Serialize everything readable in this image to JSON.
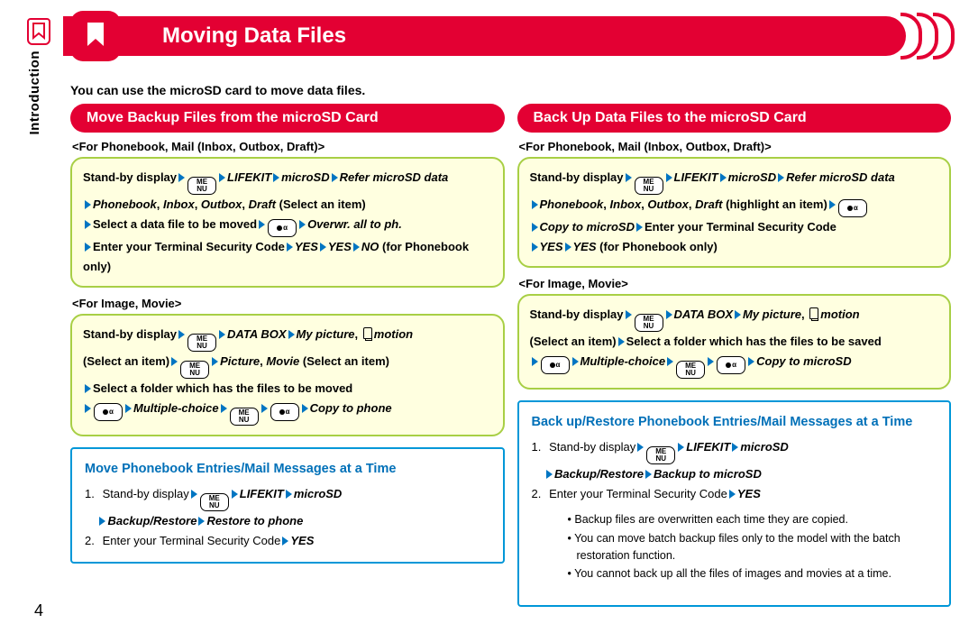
{
  "sidebar_label": "Introduction",
  "header_title": "Moving Data Files",
  "intro": "You can use the microSD card to move data files.",
  "page_number": "4",
  "keys": {
    "menu": "ME\nNU",
    "ir": "α"
  },
  "left": {
    "title": "Move Backup Files from the microSD Card",
    "sec1_heading": "<For Phonebook, Mail (Inbox, Outbox, Draft)>",
    "sec1": {
      "t1": "Stand-by display",
      "t2": "LIFEKIT",
      "t3": "microSD",
      "t4": "Refer microSD data",
      "t5": "Phonebook",
      "t6": "Inbox",
      "t7": "Outbox",
      "t8": "Draft",
      "t9": "(Select an item)",
      "t10": "Select a data file to be moved",
      "t11": "Overwr. all to ph.",
      "t12": "Enter your Terminal Security Code",
      "t13": "YES",
      "t14": "YES",
      "t15": "NO",
      "t16": "(for Phonebook only)"
    },
    "sec2_heading": "<For Image, Movie>",
    "sec2": {
      "t1": "Stand-by display",
      "t2": "DATA BOX",
      "t3": "My picture",
      "t4": "motion",
      "t5": "(Select an item)",
      "t6": "Picture",
      "t7": "Movie",
      "t8": "(Select an item)",
      "t9": "Select a folder which has the files to be moved",
      "t10": "Multiple-choice",
      "t11": "Copy to phone"
    },
    "bluebox": {
      "title": "Move Phonebook Entries/Mail Messages at a Time",
      "s1a": "Stand-by display",
      "s1b": "LIFEKIT",
      "s1c": "microSD",
      "s1d": "Backup/Restore",
      "s1e": "Restore to phone",
      "s2a": "Enter your Terminal Security Code",
      "s2b": "YES"
    }
  },
  "right": {
    "title": "Back Up Data Files to the microSD Card",
    "sec1_heading": "<For Phonebook, Mail (Inbox, Outbox, Draft)>",
    "sec1": {
      "t1": "Stand-by display",
      "t2": "LIFEKIT",
      "t3": "microSD",
      "t4": "Refer microSD data",
      "t5": "Phonebook",
      "t6": "Inbox",
      "t7": "Outbox",
      "t8": "Draft",
      "t9": "(highlight an item)",
      "t10": "Copy to microSD",
      "t11": "Enter your Terminal Security Code",
      "t12": "YES",
      "t13": "YES",
      "t14": "(for Phonebook only)"
    },
    "sec2_heading": "<For Image, Movie>",
    "sec2": {
      "t1": "Stand-by display",
      "t2": "DATA BOX",
      "t3": "My picture",
      "t4": "motion",
      "t5": "(Select an item)",
      "t6": "Select a folder which has the files to be saved",
      "t7": "Multiple-choice",
      "t8": "Copy to microSD"
    },
    "bluebox": {
      "title": "Back up/Restore Phonebook Entries/Mail Messages at a Time",
      "s1a": "Stand-by display",
      "s1b": "LIFEKIT",
      "s1c": "microSD",
      "s1d": "Backup/Restore",
      "s1e": "Backup to microSD",
      "s2a": "Enter your Terminal Security Code",
      "s2b": "YES"
    },
    "notes": [
      "Backup files are overwritten each time they are copied.",
      "You can move batch backup files only to the model with the batch restoration function.",
      "You cannot back up all the files of images and movies at a time."
    ]
  }
}
